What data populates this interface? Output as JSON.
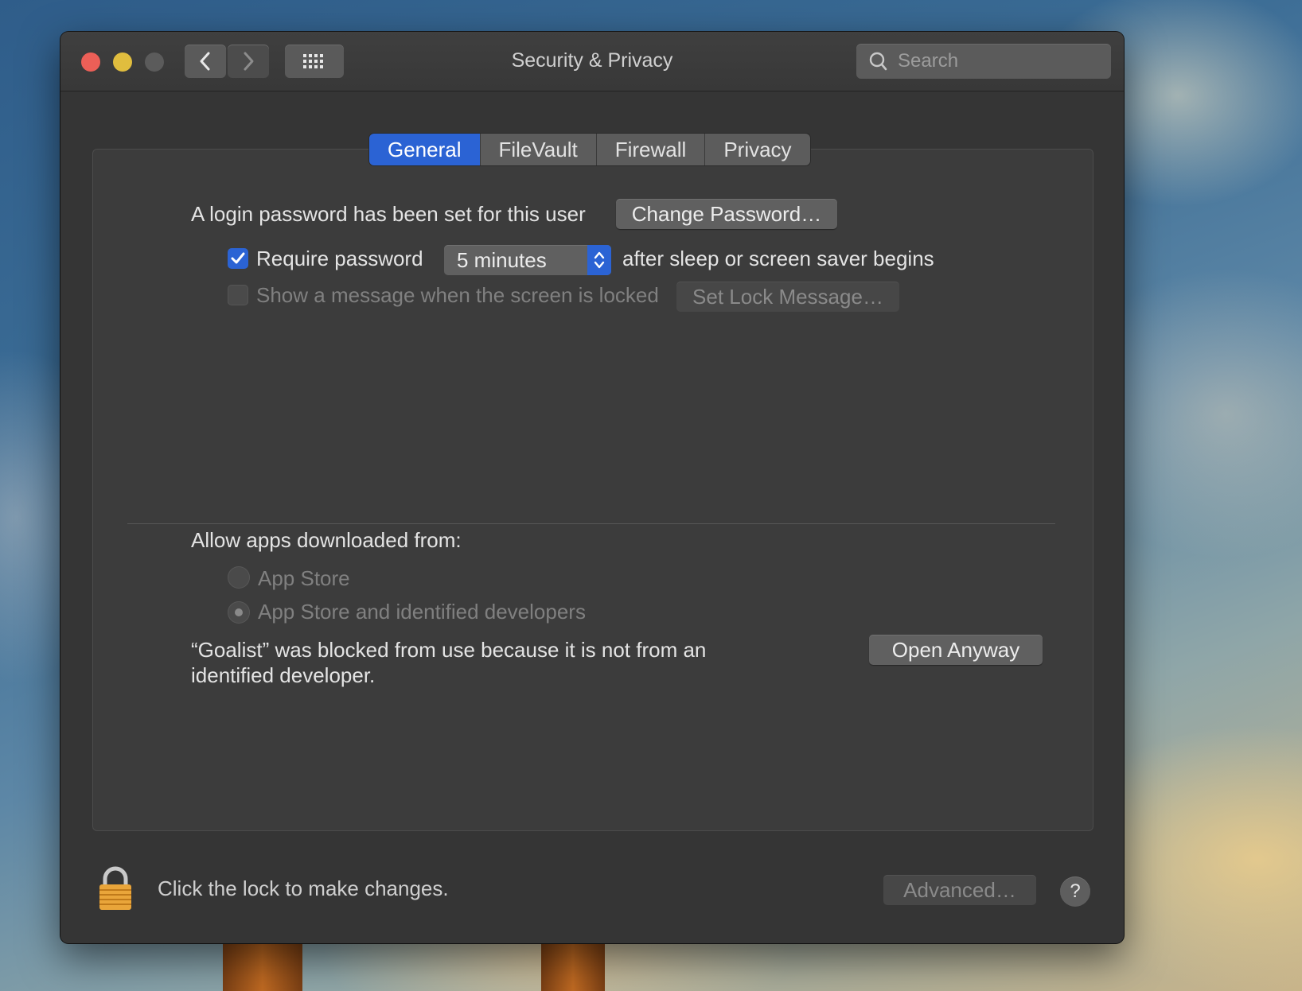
{
  "window": {
    "title": "Security & Privacy",
    "search_placeholder": "Search"
  },
  "tabs": [
    {
      "label": "General",
      "active": true
    },
    {
      "label": "FileVault",
      "active": false
    },
    {
      "label": "Firewall",
      "active": false
    },
    {
      "label": "Privacy",
      "active": false
    }
  ],
  "general": {
    "login_password_text": "A login password has been set for this user",
    "change_password_label": "Change Password…",
    "require_password": {
      "label": "Require password",
      "checked": true
    },
    "require_password_delay": "5 minutes",
    "after_sleep_text": "after sleep or screen saver begins",
    "show_message": {
      "label": "Show a message when the screen is locked",
      "checked": false
    },
    "set_lock_message_label": "Set Lock Message…"
  },
  "apps": {
    "heading": "Allow apps downloaded from:",
    "options": [
      {
        "label": "App Store",
        "selected": false
      },
      {
        "label": "App Store and identified developers",
        "selected": true
      }
    ],
    "blocked_line1": "“Goalist” was blocked from use because it is not from an",
    "blocked_line2": "identified developer.",
    "open_anyway_label": "Open Anyway"
  },
  "footer": {
    "lock_text": "Click the lock to make changes.",
    "advanced_label": "Advanced…",
    "help_label": "?"
  },
  "colors": {
    "accent": "#2b63d4",
    "close": "#ec5f57",
    "minimize": "#e0bd3e",
    "zoom_disabled": "#5b5b5b"
  }
}
